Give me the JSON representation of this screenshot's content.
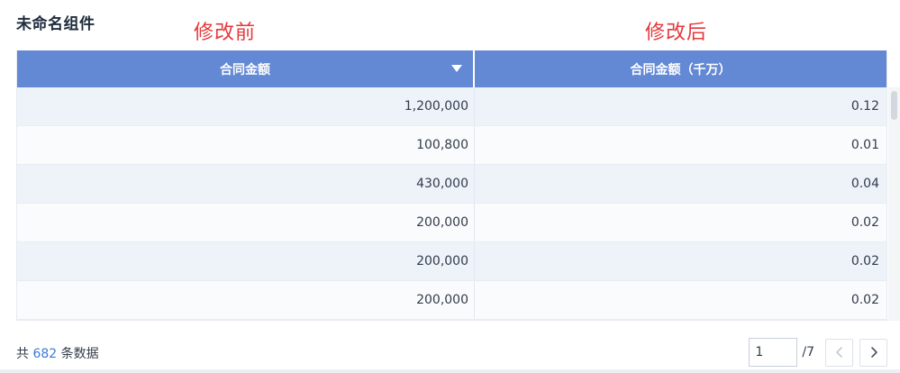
{
  "component": {
    "title": "未命名组件"
  },
  "annotations": {
    "before": "修改前",
    "after": "修改后",
    "color": "#e5383b"
  },
  "table": {
    "header_bg": "#6388d4",
    "columns": [
      {
        "label": "合同金额"
      },
      {
        "label": "合同金额（千万）"
      }
    ],
    "rows": [
      {
        "amount": "1,200,000",
        "amount_10m": "0.12"
      },
      {
        "amount": "100,800",
        "amount_10m": "0.01"
      },
      {
        "amount": "430,000",
        "amount_10m": "0.04"
      },
      {
        "amount": "200,000",
        "amount_10m": "0.02"
      },
      {
        "amount": "200,000",
        "amount_10m": "0.02"
      },
      {
        "amount": "200,000",
        "amount_10m": "0.02"
      }
    ]
  },
  "footer": {
    "prefix": "共",
    "total": "682",
    "suffix": "条数据",
    "accent": "#3d7ad9"
  },
  "pagination": {
    "current_page": "1",
    "total_pages": "/7",
    "prev_icon": "chevron-left-icon",
    "next_icon": "chevron-right-icon"
  }
}
